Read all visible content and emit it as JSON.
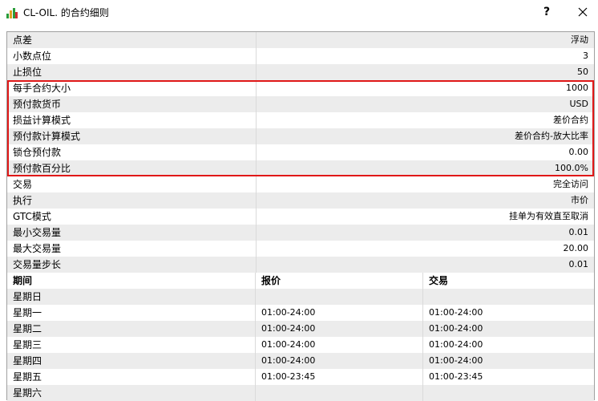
{
  "window": {
    "title": "CL-OIL. 的合约细则",
    "help_label": "?"
  },
  "specs": [
    {
      "key": "点差",
      "value": "浮动"
    },
    {
      "key": "小数点位",
      "value": "3"
    },
    {
      "key": "止损位",
      "value": "50"
    },
    {
      "key": "每手合约大小",
      "value": "1000"
    },
    {
      "key": "预付款货币",
      "value": "USD"
    },
    {
      "key": "损益计算模式",
      "value": "差价合约"
    },
    {
      "key": "预付款计算模式",
      "value": "差价合约-放大比率"
    },
    {
      "key": "锁仓预付款",
      "value": "0.00"
    },
    {
      "key": "预付款百分比",
      "value": "100.0%"
    },
    {
      "key": "交易",
      "value": "完全访问"
    },
    {
      "key": "执行",
      "value": "市价"
    },
    {
      "key": "GTC模式",
      "value": "挂单为有效直至取消"
    },
    {
      "key": "最小交易量",
      "value": "0.01"
    },
    {
      "key": "最大交易量",
      "value": "20.00"
    },
    {
      "key": "交易量步长",
      "value": "0.01"
    }
  ],
  "sessions": {
    "headers": [
      "期间",
      "报价",
      "交易"
    ],
    "rows": [
      {
        "day": "星期日",
        "quote": "",
        "trade": ""
      },
      {
        "day": "星期一",
        "quote": "01:00-24:00",
        "trade": "01:00-24:00"
      },
      {
        "day": "星期二",
        "quote": "01:00-24:00",
        "trade": "01:00-24:00"
      },
      {
        "day": "星期三",
        "quote": "01:00-24:00",
        "trade": "01:00-24:00"
      },
      {
        "day": "星期四",
        "quote": "01:00-24:00",
        "trade": "01:00-24:00"
      },
      {
        "day": "星期五",
        "quote": "01:00-23:45",
        "trade": "01:00-23:45"
      },
      {
        "day": "星期六",
        "quote": "",
        "trade": ""
      }
    ]
  },
  "colors": {
    "highlight_border": "#e01818",
    "row_alt": "#ececec",
    "row_plain": "#ffffff"
  }
}
